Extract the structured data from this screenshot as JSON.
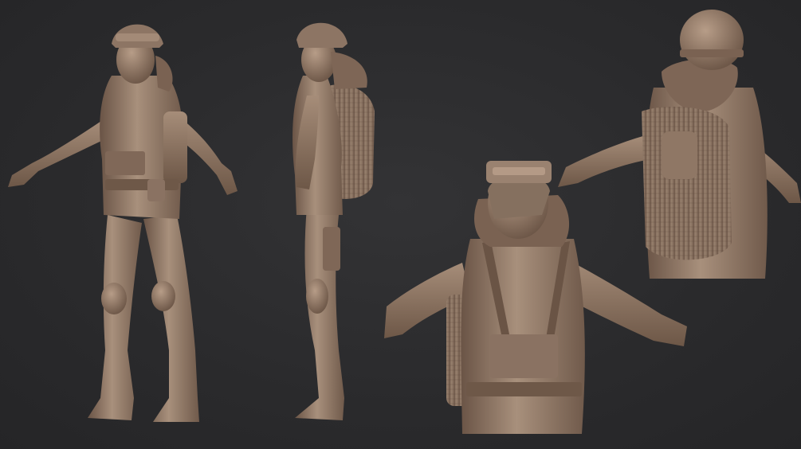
{
  "scene": {
    "background_color": "#2b2b2d",
    "material_color": "#9a8270",
    "material_shadow": "#5e4a3c",
    "material_highlight": "#c2a894",
    "views": [
      {
        "name": "front-three-quarter-view"
      },
      {
        "name": "side-view"
      },
      {
        "name": "torso-closeup-view"
      },
      {
        "name": "back-closeup-view"
      }
    ]
  }
}
